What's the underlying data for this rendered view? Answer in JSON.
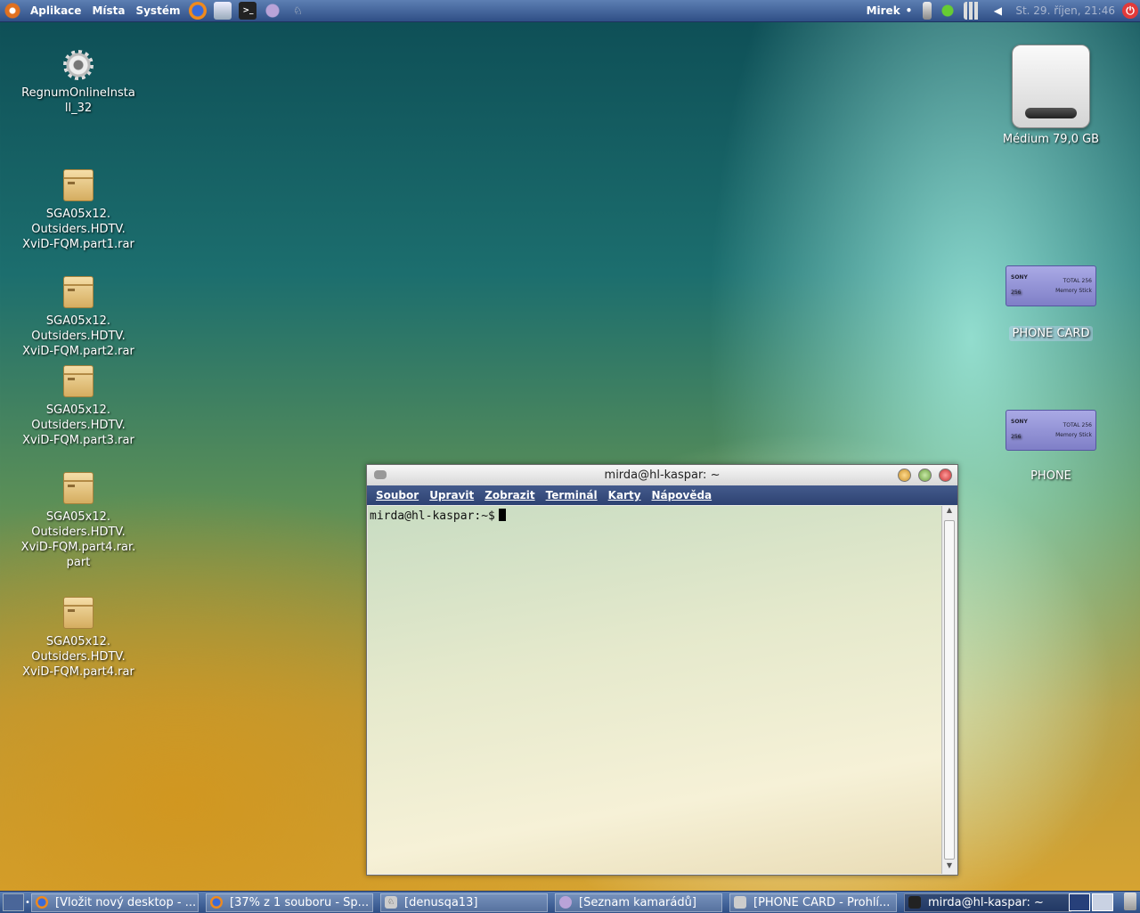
{
  "top_panel": {
    "menus": [
      "Aplikace",
      "Místa",
      "Systém"
    ],
    "user": "Mirek",
    "clock": "St. 29. říjen, 21:46"
  },
  "desktop_icons": [
    {
      "label": "RegnumOnlineInstall_32"
    },
    {
      "label": "SGA05x12.\nOutsiders.HDTV.\nXviD-FQM.part1.rar"
    },
    {
      "label": "SGA05x12.\nOutsiders.HDTV.\nXviD-FQM.part2.rar"
    },
    {
      "label": "SGA05x12.\nOutsiders.HDTV.\nXviD-FQM.part3.rar"
    },
    {
      "label": "SGA05x12.\nOutsiders.HDTV.\nXviD-FQM.part4.rar.\npart"
    },
    {
      "label": "SGA05x12.\nOutsiders.HDTV.\nXviD-FQM.part4.rar"
    }
  ],
  "right_icons": {
    "hdd": "Médium 79,0 GB",
    "card1": "PHONE CARD",
    "card2": "PHONE",
    "memstick_brand": "SONY",
    "memstick_total": "TOTAL 256",
    "memstick_name": "Memory Stick",
    "memstick_size": "256"
  },
  "terminal": {
    "title": "mirda@hl-kaspar: ~",
    "menu": [
      "Soubor",
      "Upravit",
      "Zobrazit",
      "Terminál",
      "Karty",
      "Nápověda"
    ],
    "prompt": "mirda@hl-kaspar:~$"
  },
  "taskbar": {
    "tasks": [
      "[Vložit nový desktop - ...",
      "[37% z 1 souboru - Sp...",
      "[denusqa13]",
      "[Seznam kamarádů]",
      "[PHONE CARD - Prohlí...",
      "mirda@hl-kaspar: ~"
    ]
  }
}
